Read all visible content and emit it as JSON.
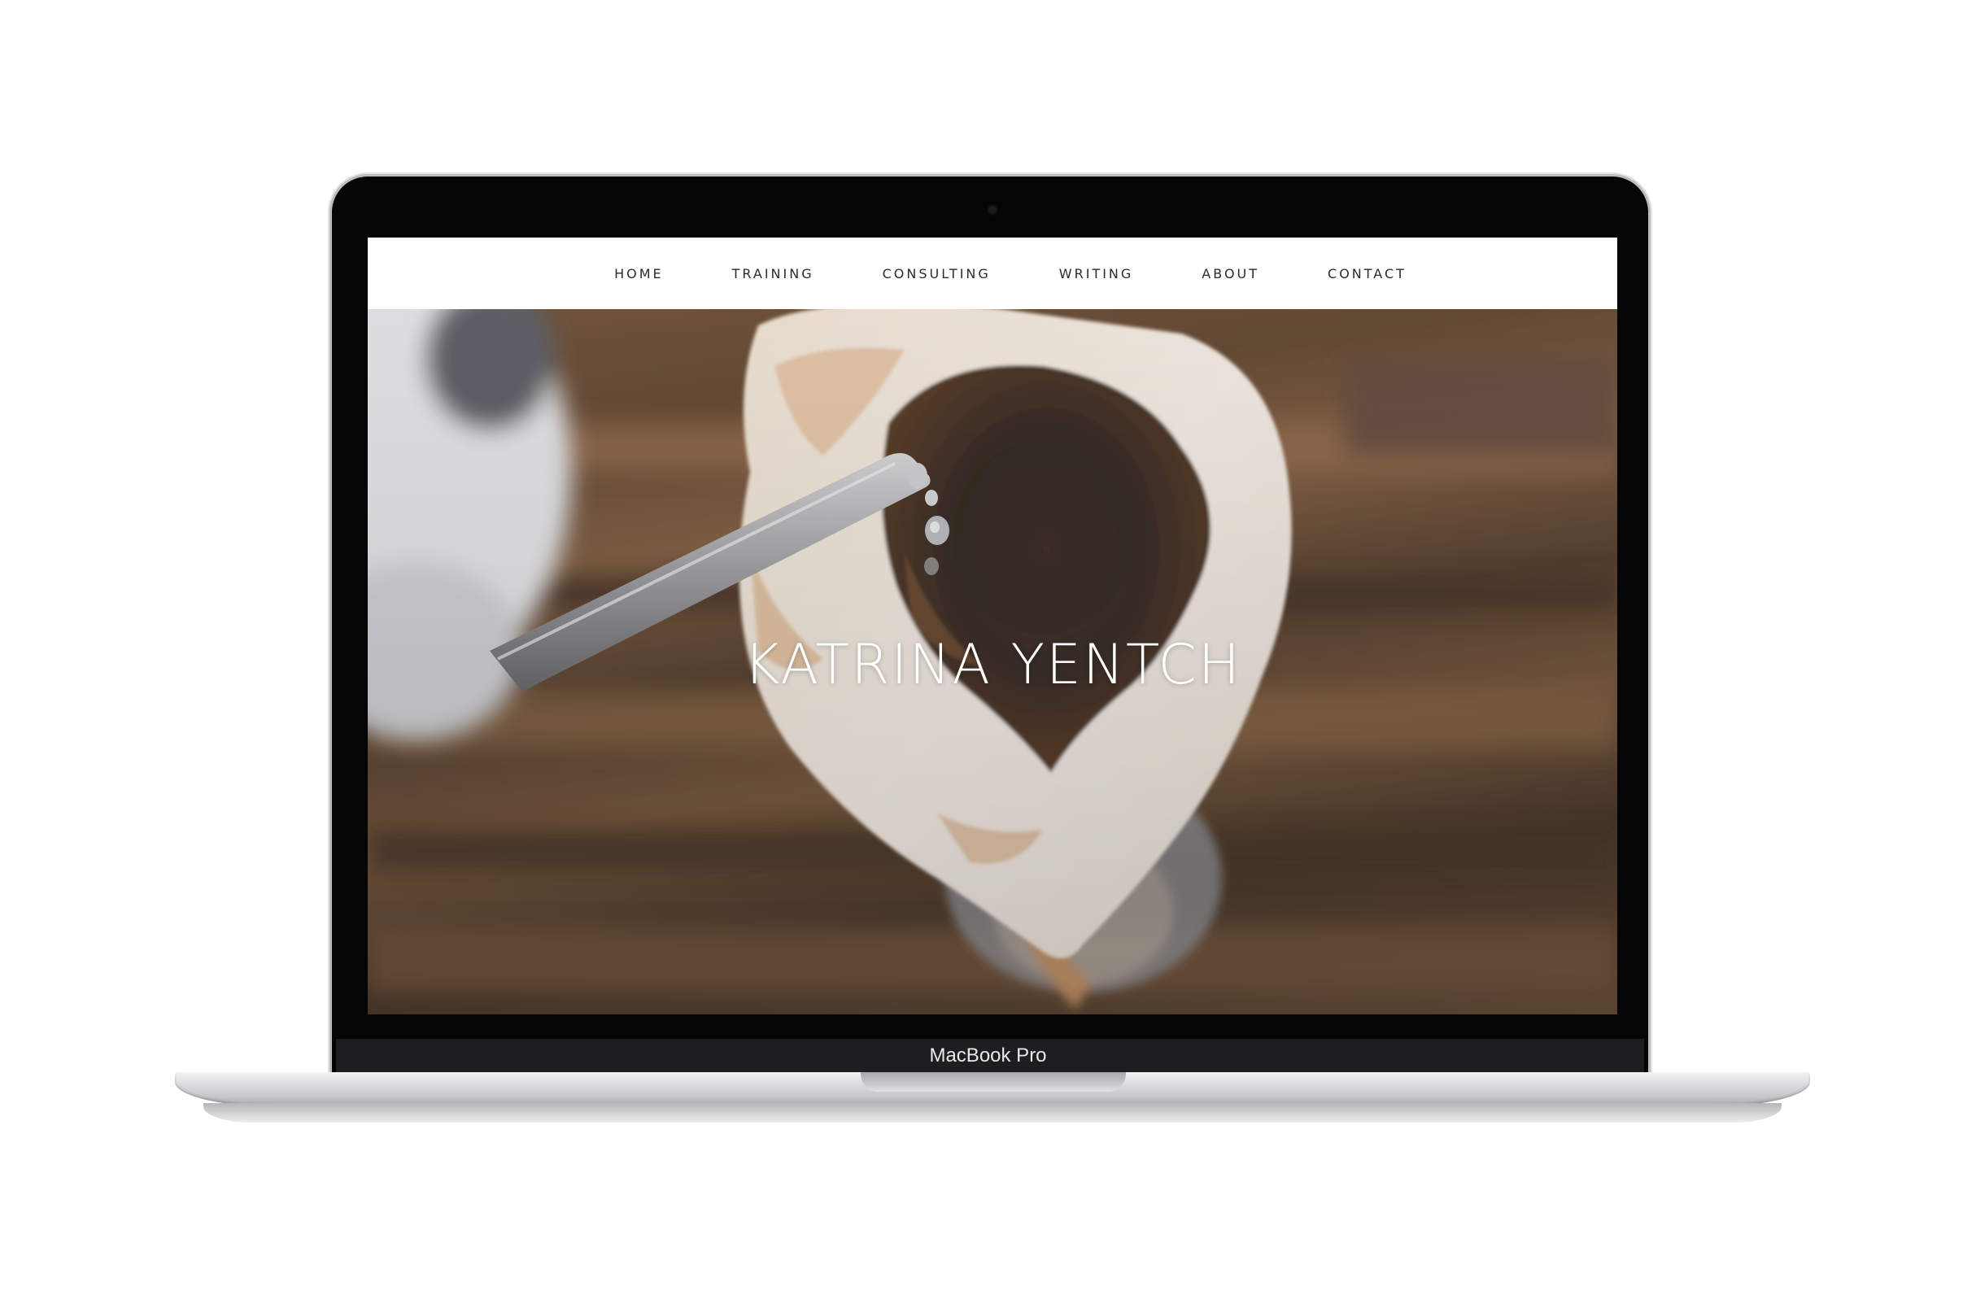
{
  "device": {
    "brand_label": "MacBook Pro"
  },
  "site": {
    "nav": {
      "items": [
        {
          "label": "HOME"
        },
        {
          "label": "TRAINING"
        },
        {
          "label": "CONSULTING"
        },
        {
          "label": "WRITING"
        },
        {
          "label": "ABOUT"
        },
        {
          "label": "CONTACT"
        }
      ]
    },
    "hero": {
      "title": "KATRINA YENTCH",
      "image_subject": "pour-over coffee filter with kettle spout"
    }
  },
  "colors": {
    "nav_background": "#ffffff",
    "nav_text": "#2b2b2b",
    "hero_text": "#ffffff",
    "bezel": "#050505",
    "chassis": "#d6d6d8"
  }
}
